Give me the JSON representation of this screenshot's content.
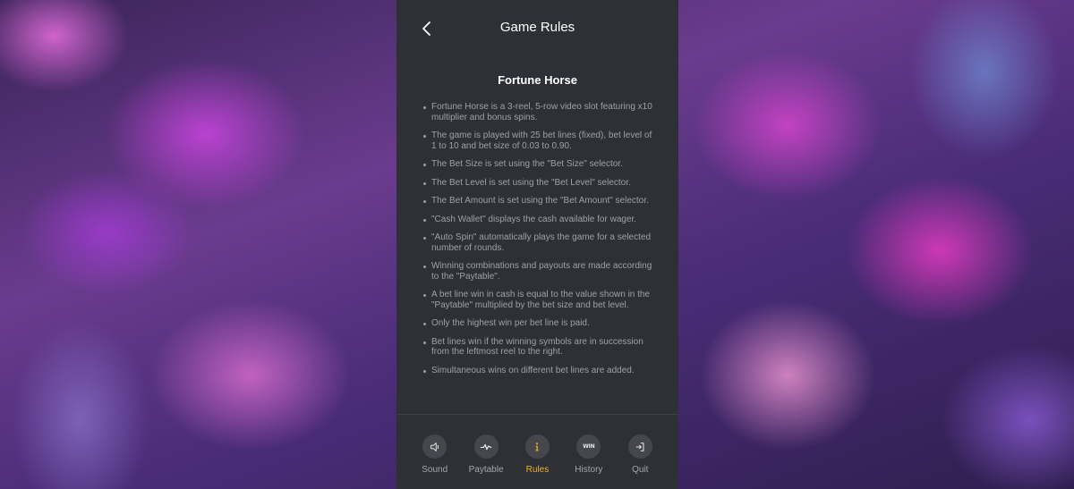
{
  "header": {
    "title": "Game Rules"
  },
  "content": {
    "game_name": "Fortune Horse",
    "rules": [
      "Fortune Horse is a 3-reel, 5-row video slot featuring x10 multiplier and bonus spins.",
      "The game is played with 25 bet lines (fixed), bet level of 1 to 10 and bet size of 0.03 to 0.90.",
      "The Bet Size is set using the \"Bet Size\" selector.",
      "The Bet Level is set using the \"Bet Level\" selector.",
      "The Bet Amount is set using the \"Bet Amount\" selector.",
      "\"Cash Wallet\" displays the cash available for wager.",
      "\"Auto Spin\" automatically plays the game for a selected number of rounds.",
      "Winning combinations and payouts are made according to the \"Paytable\".",
      "A bet line win in cash is equal to the value shown in the \"Paytable\" multiplied by the bet size and bet level.",
      "Only the highest win per bet line is paid.",
      "Bet lines win if the winning symbols are in succession from the leftmost reel to the right.",
      "Simultaneous wins on different bet lines are added."
    ]
  },
  "nav": {
    "items": [
      {
        "label": "Sound",
        "icon": "speaker-icon"
      },
      {
        "label": "Paytable",
        "icon": "pulse-icon"
      },
      {
        "label": "Rules",
        "icon": "info-icon",
        "active": true
      },
      {
        "label": "History",
        "icon": "win-icon",
        "icon_text": "WIN"
      },
      {
        "label": "Quit",
        "icon": "exit-icon"
      }
    ]
  },
  "colors": {
    "panel": "#2e3036",
    "active": "#f2b21a",
    "text_muted": "#9ea0a6"
  }
}
